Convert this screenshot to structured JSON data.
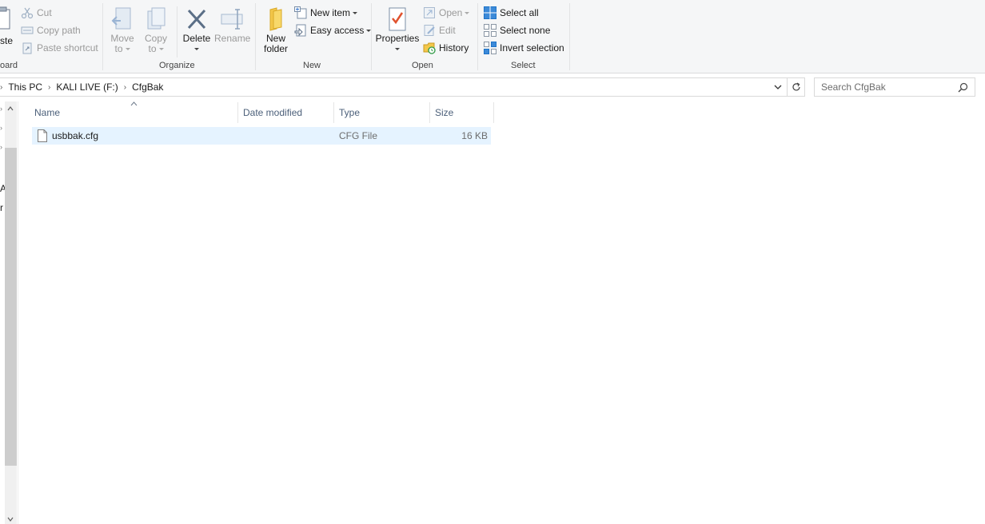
{
  "ribbon": {
    "clipboard": {
      "paste_label": "ste",
      "cut_label": "Cut",
      "copy_path_label": "Copy path",
      "paste_shortcut_label": "Paste shortcut",
      "group_label": "oard"
    },
    "organize": {
      "move_to_line1": "Move",
      "move_to_line2": "to",
      "copy_to_line1": "Copy",
      "copy_to_line2": "to",
      "delete_label": "Delete",
      "rename_label": "Rename",
      "group_label": "Organize"
    },
    "new": {
      "new_folder_line1": "New",
      "new_folder_line2": "folder",
      "new_item_label": "New item",
      "easy_access_label": "Easy access",
      "group_label": "New"
    },
    "open": {
      "properties_label": "Properties",
      "open_label": "Open",
      "edit_label": "Edit",
      "history_label": "History",
      "group_label": "Open"
    },
    "select": {
      "select_all_label": "Select all",
      "select_none_label": "Select none",
      "invert_selection_label": "Invert selection",
      "group_label": "Select"
    }
  },
  "address": {
    "breadcrumbs": [
      "This PC",
      "KALI LIVE (F:)",
      "CfgBak"
    ],
    "search_placeholder": "Search CfgBak"
  },
  "nav_pane": {
    "clipped_texts": [
      "A",
      "r"
    ]
  },
  "file_list": {
    "columns": [
      "Name",
      "Date modified",
      "Type",
      "Size"
    ],
    "rows": [
      {
        "name": "usbbak.cfg",
        "date_modified": "",
        "type": "CFG File",
        "size": "16 KB"
      }
    ]
  },
  "colors": {
    "ribbon_bg": "#f5f6f7",
    "selection_bg": "#e5f3ff",
    "header_text": "#4c607a",
    "accent_blue": "#1e73c8"
  }
}
